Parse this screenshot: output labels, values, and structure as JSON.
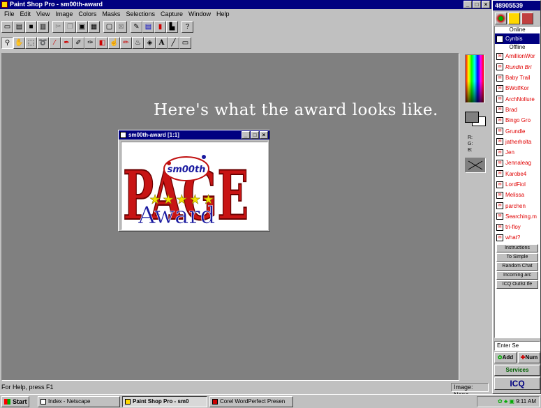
{
  "window": {
    "title": "Paint Shop Pro - sm00th-award",
    "btn_min": "_",
    "btn_max": "□",
    "btn_close": "×"
  },
  "menu": [
    "File",
    "Edit",
    "View",
    "Image",
    "Colors",
    "Masks",
    "Selections",
    "Capture",
    "Window",
    "Help"
  ],
  "toolbar1": [
    "new-icon",
    "open-icon",
    "save-icon",
    "print-icon",
    "cut-icon",
    "copy-icon",
    "paste-icon",
    "browse-icon",
    "full-screen-icon",
    "preview-icon",
    "toggle-tools-icon",
    "toggle-palette-icon",
    "toggle-histogram-icon",
    "toggle-status-icon",
    "help-icon"
  ],
  "toolbar2": [
    "zoom-icon",
    "mover-icon",
    "selection-icon",
    "lasso-icon",
    "magic-wand-icon",
    "dropper-icon",
    "paintbrush-icon",
    "clone-icon",
    "color-replacer-icon",
    "retouch-icon",
    "eraser-icon",
    "picture-tube-icon",
    "flood-fill-icon",
    "text-icon",
    "line-icon",
    "shapes-icon"
  ],
  "workspace": {
    "headline": "Here's what the award looks like."
  },
  "document": {
    "title": "sm00th-award [1:1]",
    "oval_text": "sm00th",
    "page_text": "PAGE",
    "award_text": "Award",
    "stars": "★★★★★"
  },
  "palette": {
    "rgb_r": "R:",
    "rgb_g": "G:",
    "rgb_b": "B:"
  },
  "status": {
    "help": "For Help, press F1",
    "image": "Image: None"
  },
  "icq": {
    "title": "48905539",
    "group_online": "Online",
    "online": [
      "Cynbis"
    ],
    "group_offline": "Offline",
    "offline": [
      "AmillionWor",
      "Rundin Bri",
      "Baby Trail",
      "BWolfKor",
      "ArchNollure",
      "Brad",
      "Bingo Gro",
      "Grundle",
      "jatherholta",
      "Jen",
      "Jennaleag",
      "Karobe4",
      "LordFiol",
      "Melissa",
      "parchen",
      "Searching.m",
      "tri-floy",
      "what?"
    ],
    "system": [
      "Instructions",
      "To Simple",
      "Random Chat",
      "Incoming arc",
      "ICQ Outlst Ife"
    ],
    "enter": "Enter Se",
    "add": "Add",
    "num": "Num",
    "services": "Services",
    "logo": "ICQ"
  },
  "taskbar": {
    "start": "Start",
    "tasks": [
      "Index - Netscape",
      "Paint Shop Pro - sm0",
      "Corel WordPerfect Presen"
    ],
    "clock": "9:11 AM"
  },
  "colors": {
    "titlebar": "#000080",
    "workspace": "#808080",
    "offline_contact": "#e00000"
  }
}
